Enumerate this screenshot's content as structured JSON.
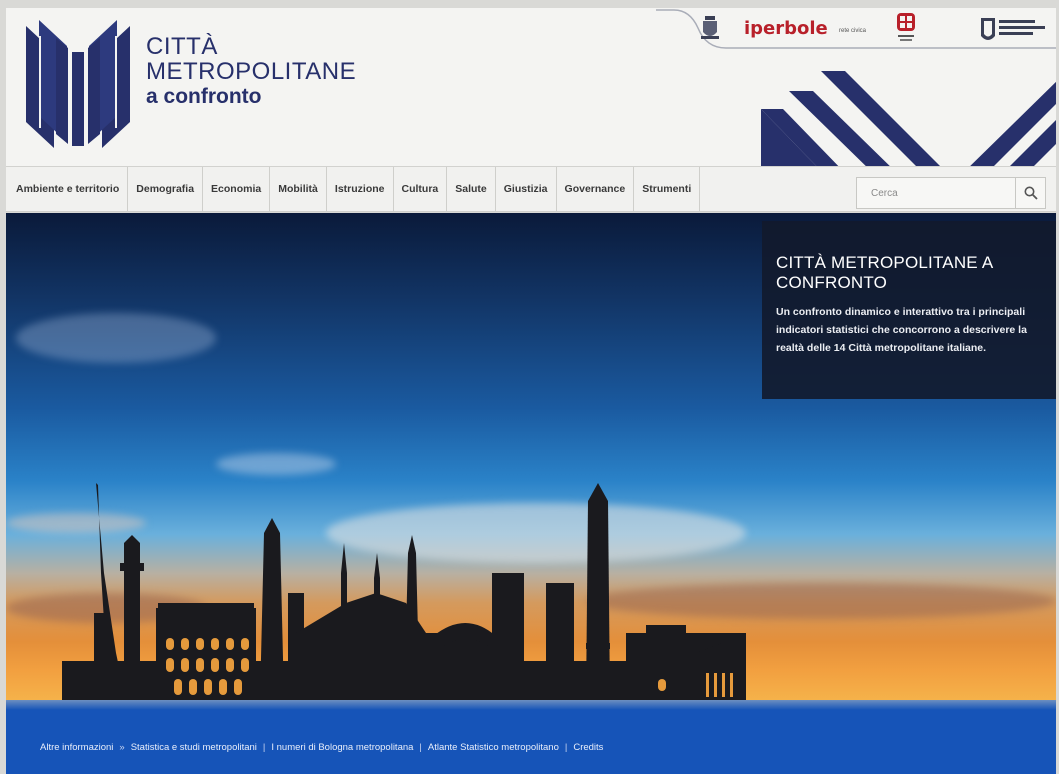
{
  "header": {
    "logo_line1": "CITTÀ",
    "logo_line2": "METROPOLITANE",
    "logo_line3": "a confronto",
    "partners": {
      "iperbole": "iperbole",
      "rete_civica": "rete civica"
    }
  },
  "nav": {
    "items": [
      {
        "label": "Ambiente e territorio"
      },
      {
        "label": "Demografia"
      },
      {
        "label": "Economia"
      },
      {
        "label": "Mobilità"
      },
      {
        "label": "Istruzione"
      },
      {
        "label": "Cultura"
      },
      {
        "label": "Salute"
      },
      {
        "label": "Giustizia"
      },
      {
        "label": "Governance"
      },
      {
        "label": "Strumenti"
      }
    ],
    "search_placeholder": "Cerca"
  },
  "hero": {
    "title": "CITTÀ METROPOLITANE A CONFRONTO",
    "description": "Un confronto dinamico e interattivo tra i principali indicatori statistici che concorrono a descrivere la realtà delle 14 Città metropolitane italiane."
  },
  "footer": {
    "intro": "Altre informazioni",
    "links": [
      "Statistica e studi metropolitani",
      "I numeri di Bologna metropolitana",
      "Atlante Statistico metropolitano",
      "Credits"
    ]
  },
  "colors": {
    "brand_navy": "#27306b",
    "iperbole_red": "#b8202a",
    "footer_blue": "#1654b8"
  }
}
